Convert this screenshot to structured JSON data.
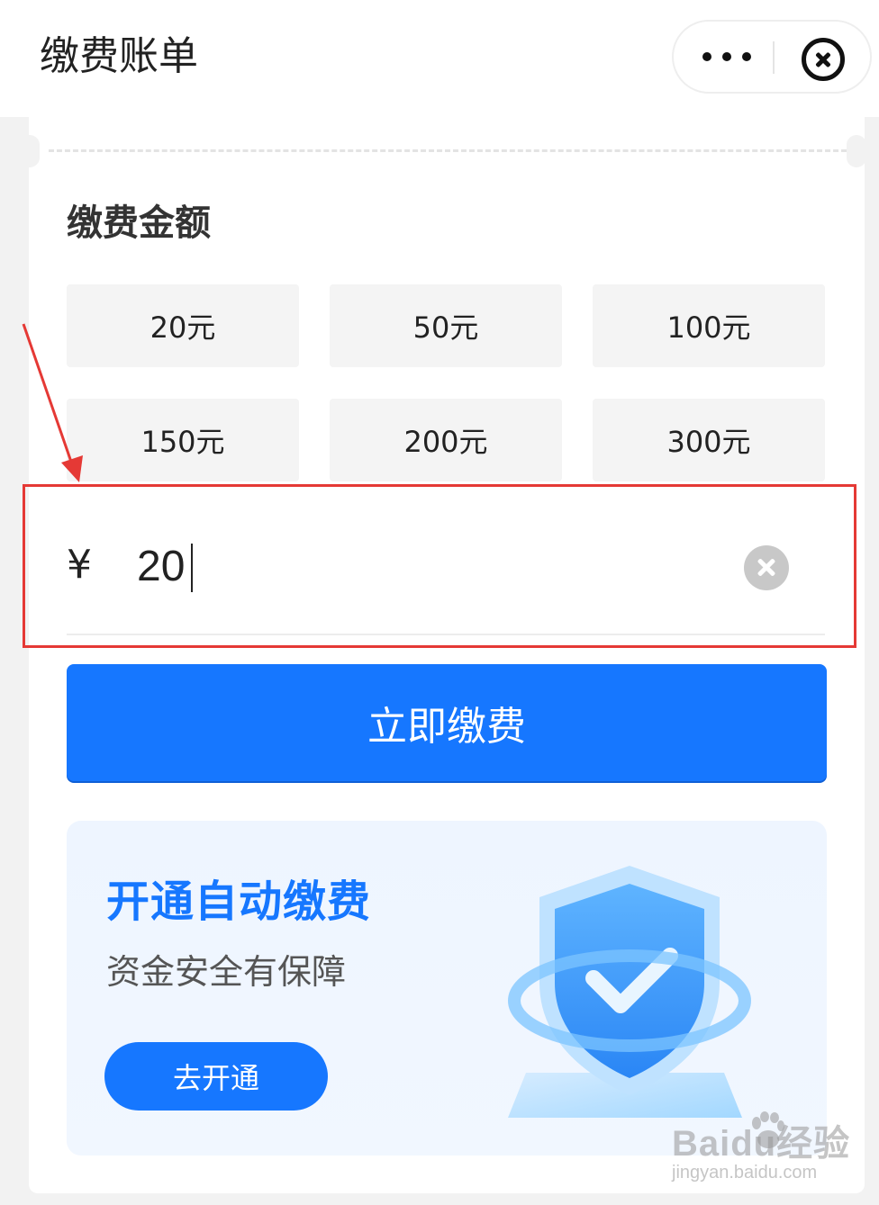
{
  "header": {
    "title": "缴费账单"
  },
  "section": {
    "title": "缴费金额"
  },
  "amounts": [
    "20元",
    "50元",
    "100元",
    "150元",
    "200元",
    "300元"
  ],
  "input": {
    "currency": "¥",
    "value": "20"
  },
  "pay_button": {
    "label": "立即缴费"
  },
  "promo": {
    "title": "开通自动缴费",
    "subtitle": "资金安全有保障",
    "button": "去开通"
  },
  "watermark": {
    "brand": "Baidu经验",
    "url": "jingyan.baidu.com"
  },
  "colors": {
    "primary": "#1677ff",
    "highlight": "#e53935"
  }
}
